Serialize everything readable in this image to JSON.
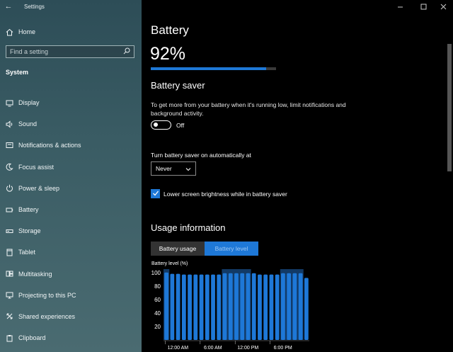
{
  "app": {
    "title": "Settings"
  },
  "sidebar": {
    "home": {
      "label": "Home",
      "icon": "home-icon"
    },
    "search": {
      "placeholder": "Find a setting"
    },
    "section": "System",
    "items": [
      {
        "label": "Display",
        "icon": "display-icon"
      },
      {
        "label": "Sound",
        "icon": "sound-icon"
      },
      {
        "label": "Notifications & actions",
        "icon": "notifications-icon"
      },
      {
        "label": "Focus assist",
        "icon": "moon-icon"
      },
      {
        "label": "Power & sleep",
        "icon": "power-icon"
      },
      {
        "label": "Battery",
        "icon": "battery-icon"
      },
      {
        "label": "Storage",
        "icon": "storage-icon"
      },
      {
        "label": "Tablet",
        "icon": "tablet-icon"
      },
      {
        "label": "Multitasking",
        "icon": "multitasking-icon"
      },
      {
        "label": "Projecting to this PC",
        "icon": "projector-icon"
      },
      {
        "label": "Shared experiences",
        "icon": "share-icon"
      },
      {
        "label": "Clipboard",
        "icon": "clipboard-icon"
      }
    ]
  },
  "main": {
    "title": "Battery",
    "percent_text": "92%",
    "percent": 0.92,
    "saver": {
      "heading": "Battery saver",
      "description": "To get more from your battery when it's running low, limit notifications and background activity.",
      "toggle_state": "Off",
      "auto_label": "Turn battery saver on automatically at",
      "auto_value": "Never",
      "brightness_label": "Lower screen brightness while in battery saver",
      "brightness_checked": true
    },
    "usage": {
      "heading": "Usage information",
      "tabs": [
        {
          "label": "Battery usage",
          "active": false
        },
        {
          "label": "Battery level",
          "active": true
        }
      ]
    }
  },
  "colors": {
    "accent": "#1e78d7",
    "sidebar_bg": "#3a5c64",
    "background": "#000000"
  },
  "chart_data": {
    "type": "bar",
    "ylabel": "Battery level (%)",
    "yticks": [
      100,
      80,
      60,
      40,
      20
    ],
    "ylim": [
      0,
      105
    ],
    "xticks": [
      "12:00 AM",
      "6:00 AM",
      "12:00 PM",
      "6:00 PM"
    ],
    "charging_periods_bars": [
      [
        0,
        1
      ],
      [
        10,
        15
      ],
      [
        20,
        24
      ]
    ],
    "values": [
      100,
      98,
      98,
      97,
      97,
      97,
      97,
      97,
      97,
      97,
      99,
      99,
      99,
      99,
      99,
      99,
      97,
      97,
      97,
      97,
      99,
      99,
      99,
      99,
      92
    ]
  }
}
